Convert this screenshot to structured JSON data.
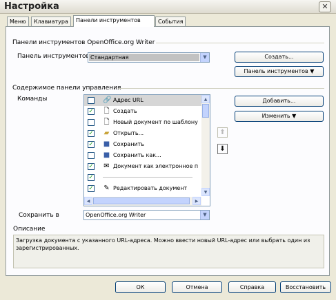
{
  "window": {
    "title": "Настройка",
    "close_glyph": "✕"
  },
  "tabs": [
    {
      "label": "Меню"
    },
    {
      "label": "Клавиатура"
    },
    {
      "label": "Панели инструментов",
      "active": true
    },
    {
      "label": "События"
    }
  ],
  "toolbars_group": {
    "heading": "Панели инструментов OpenOffice.org Writer",
    "toolbar_label": "Панель инструментов",
    "toolbar_value": "Стандартная",
    "new_button": "Создать...",
    "toolbar_menu_button": "Панель инструментов ▼"
  },
  "content_group": {
    "heading": "Содержимое панели управления",
    "commands_label": "Команды",
    "add_button": "Добавить...",
    "modify_button": "Изменить ▼",
    "commands": [
      {
        "text": "Адрес URL",
        "checked": false,
        "icon": "url-icon",
        "selected": true
      },
      {
        "text": "Создать",
        "checked": true,
        "icon": "new-doc-icon"
      },
      {
        "text": "Новый документ по шаблону",
        "checked": false,
        "icon": "template-doc-icon"
      },
      {
        "text": "Открыть...",
        "checked": true,
        "icon": "open-folder-icon"
      },
      {
        "text": "Сохранить",
        "checked": true,
        "icon": "save-icon"
      },
      {
        "text": "Сохранить как...",
        "checked": false,
        "icon": "save-as-icon"
      },
      {
        "text": "Документ как электронное п",
        "checked": true,
        "icon": "mail-icon"
      },
      {
        "text": "",
        "checked": true,
        "icon": ""
      },
      {
        "text": "Редактировать документ",
        "checked": true,
        "icon": "edit-doc-icon"
      }
    ],
    "save_in_label": "Сохранить в",
    "save_in_value": "OpenOffice.org Writer"
  },
  "description": {
    "heading": "Описание",
    "text": "Загрузка документа с указанного URL-адреса. Можно ввести новый URL-адрес или выбрать один из зарегистрированных."
  },
  "footer": {
    "ok": "ОК",
    "cancel": "Отмена",
    "help": "Справка",
    "reset": "Восстановить"
  }
}
